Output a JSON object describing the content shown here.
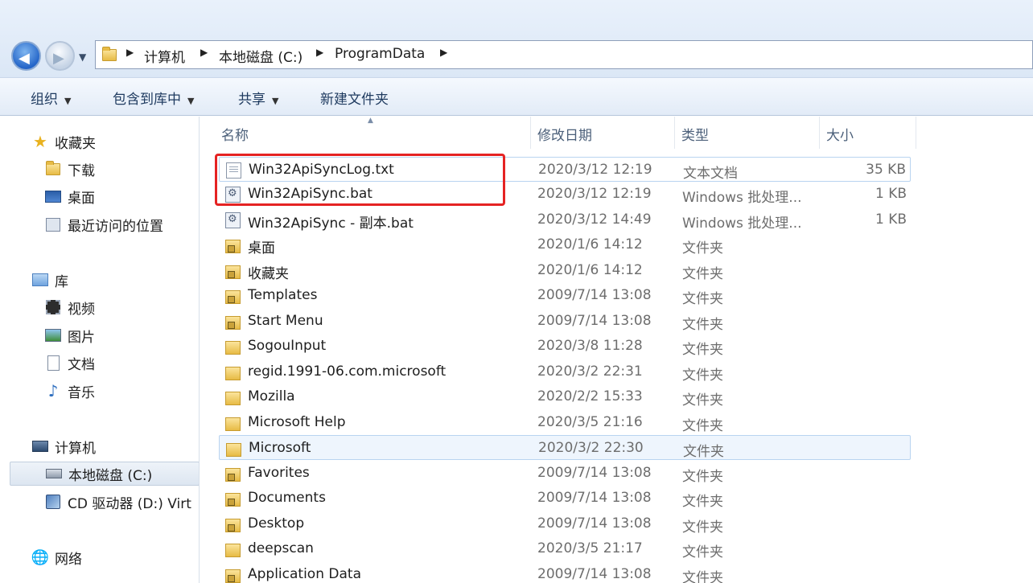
{
  "address_bar": {
    "crumbs": [
      "计算机",
      "本地磁盘 (C:)",
      "ProgramData"
    ]
  },
  "toolbar": {
    "organize": "组织",
    "include_library": "包含到库中",
    "share": "共享",
    "new_folder": "新建文件夹"
  },
  "sidebar": {
    "favorites": "收藏夹",
    "downloads": "下载",
    "desktop": "桌面",
    "recent": "最近访问的位置",
    "libraries": "库",
    "videos": "视频",
    "pictures": "图片",
    "documents": "文档",
    "music": "音乐",
    "computer": "计算机",
    "local_disk": "本地磁盘 (C:)",
    "cd_drive": "CD 驱动器 (D:) Virt",
    "network": "网络"
  },
  "columns": {
    "name": "名称",
    "date": "修改日期",
    "type": "类型",
    "size": "大小"
  },
  "files": [
    {
      "name": "Win32ApiSyncLog.txt",
      "date": "2020/3/12 12:19",
      "type": "文本文档",
      "size": "35 KB",
      "icon": "text-file-icon"
    },
    {
      "name": "Win32ApiSync.bat",
      "date": "2020/3/12 12:19",
      "type": "Windows 批处理...",
      "size": "1 KB",
      "icon": "batch-file-icon"
    },
    {
      "name": "Win32ApiSync - 副本.bat",
      "date": "2020/3/12 14:49",
      "type": "Windows 批处理...",
      "size": "1 KB",
      "icon": "batch-file-icon"
    },
    {
      "name": "桌面",
      "date": "2020/1/6 14:12",
      "type": "文件夹",
      "size": "",
      "icon": "locked-folder-icon"
    },
    {
      "name": "收藏夹",
      "date": "2020/1/6 14:12",
      "type": "文件夹",
      "size": "",
      "icon": "locked-folder-icon"
    },
    {
      "name": "Templates",
      "date": "2009/7/14 13:08",
      "type": "文件夹",
      "size": "",
      "icon": "locked-folder-icon"
    },
    {
      "name": "Start Menu",
      "date": "2009/7/14 13:08",
      "type": "文件夹",
      "size": "",
      "icon": "locked-folder-icon"
    },
    {
      "name": "SogouInput",
      "date": "2020/3/8 11:28",
      "type": "文件夹",
      "size": "",
      "icon": "folder-icon"
    },
    {
      "name": "regid.1991-06.com.microsoft",
      "date": "2020/3/2 22:31",
      "type": "文件夹",
      "size": "",
      "icon": "folder-icon"
    },
    {
      "name": "Mozilla",
      "date": "2020/2/2 15:33",
      "type": "文件夹",
      "size": "",
      "icon": "folder-icon"
    },
    {
      "name": "Microsoft Help",
      "date": "2020/3/5 21:16",
      "type": "文件夹",
      "size": "",
      "icon": "folder-icon"
    },
    {
      "name": "Microsoft",
      "date": "2020/3/2 22:30",
      "type": "文件夹",
      "size": "",
      "icon": "folder-icon"
    },
    {
      "name": "Favorites",
      "date": "2009/7/14 13:08",
      "type": "文件夹",
      "size": "",
      "icon": "locked-folder-icon"
    },
    {
      "name": "Documents",
      "date": "2009/7/14 13:08",
      "type": "文件夹",
      "size": "",
      "icon": "locked-folder-icon"
    },
    {
      "name": "Desktop",
      "date": "2009/7/14 13:08",
      "type": "文件夹",
      "size": "",
      "icon": "locked-folder-icon"
    },
    {
      "name": "deepscan",
      "date": "2020/3/5 21:17",
      "type": "文件夹",
      "size": "",
      "icon": "folder-icon"
    },
    {
      "name": "Application Data",
      "date": "2009/7/14 13:08",
      "type": "文件夹",
      "size": "",
      "icon": "locked-folder-icon"
    }
  ],
  "colors": {
    "highlight": "#e52323",
    "hover_row": "#eef5fd"
  }
}
